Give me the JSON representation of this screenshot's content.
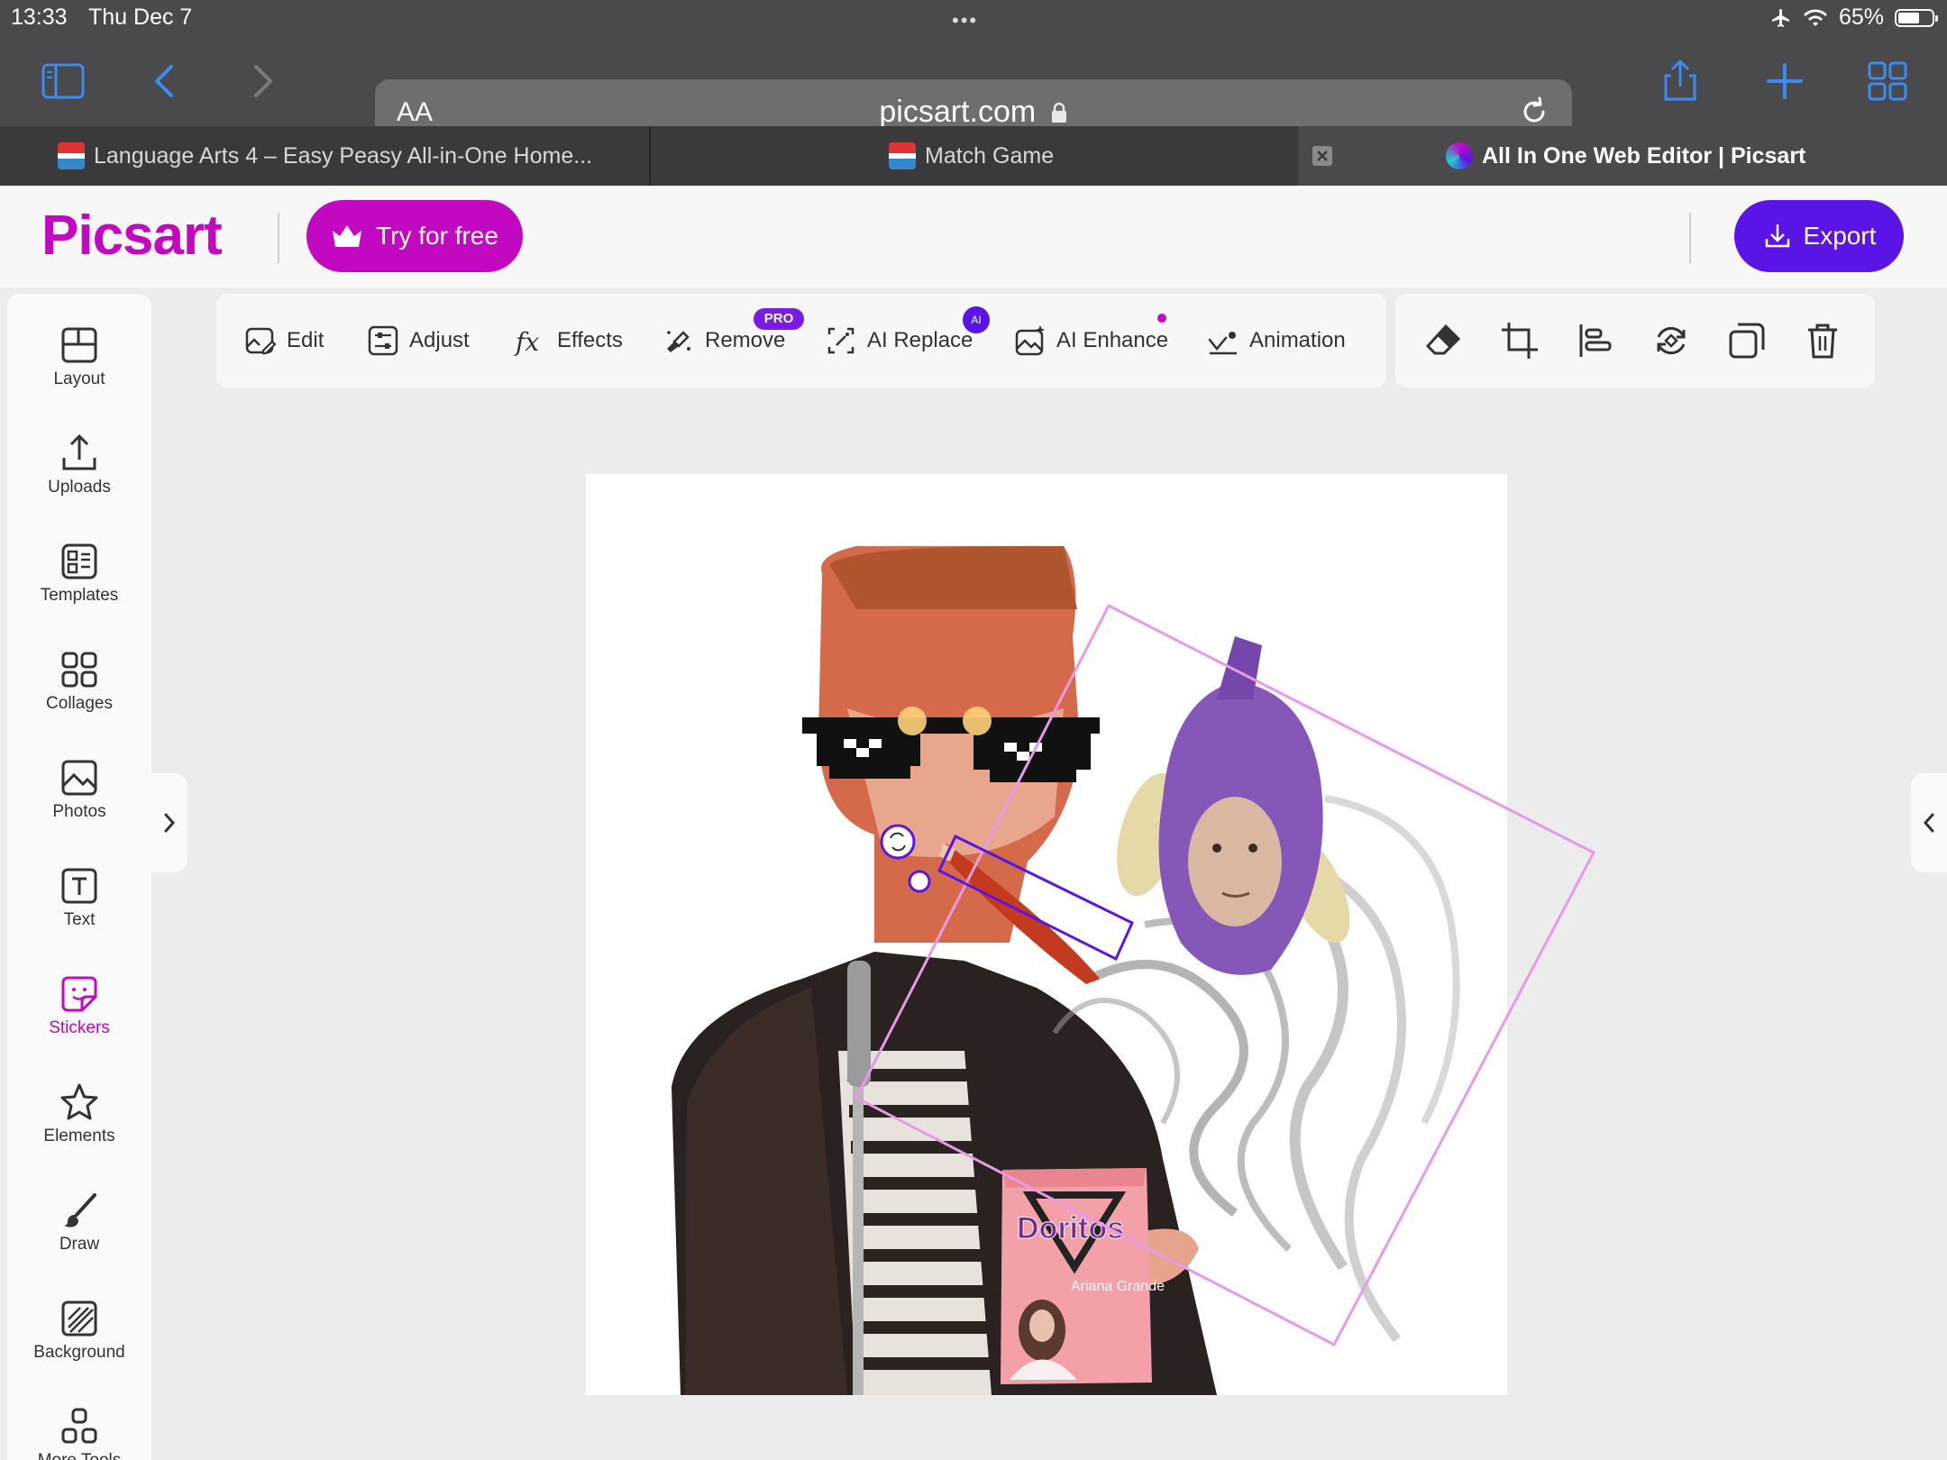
{
  "status": {
    "time": "13:33",
    "date": "Thu Dec 7",
    "battery": "65%",
    "battery_level": 0.65
  },
  "browser": {
    "url_prefix": "AA",
    "url": "picsart.com",
    "tabs": [
      {
        "label": "Language Arts 4 – Easy Peasy All-in-One Home...",
        "active": false
      },
      {
        "label": "Match Game",
        "active": false
      },
      {
        "label": "All In One Web Editor | Picsart",
        "active": true
      }
    ]
  },
  "header": {
    "logo": "Picsart",
    "try_label": "Try for free",
    "export_label": "Export"
  },
  "sidebar": {
    "items": [
      {
        "label": "Layout",
        "icon": "layout-icon"
      },
      {
        "label": "Uploads",
        "icon": "upload-icon"
      },
      {
        "label": "Templates",
        "icon": "templates-icon"
      },
      {
        "label": "Collages",
        "icon": "collages-icon"
      },
      {
        "label": "Photos",
        "icon": "photos-icon"
      },
      {
        "label": "Text",
        "icon": "text-icon"
      },
      {
        "label": "Stickers",
        "icon": "sticker-icon",
        "active": true
      },
      {
        "label": "Elements",
        "icon": "star-icon"
      },
      {
        "label": "Draw",
        "icon": "brush-icon"
      },
      {
        "label": "Background",
        "icon": "background-icon"
      },
      {
        "label": "More Tools",
        "icon": "more-tools-icon"
      }
    ]
  },
  "tools": {
    "items": [
      {
        "label": "Edit"
      },
      {
        "label": "Adjust"
      },
      {
        "label": "Effects"
      },
      {
        "label": "Remove",
        "badge": "PRO"
      },
      {
        "label": "AI Replace",
        "badge": "AI"
      },
      {
        "label": "AI Enhance"
      },
      {
        "label": "Animation"
      }
    ],
    "actions": [
      "eraser-icon",
      "crop-icon",
      "align-icon",
      "flip-icon",
      "duplicate-icon",
      "trash-icon"
    ]
  },
  "canvas": {
    "stickers": [
      "sunglasses",
      "cigarette",
      "smoke",
      "purple-costume",
      "chips-bag"
    ],
    "chips_brand": "Doritos",
    "chips_sub": "Ariana Grande",
    "accent": "#c209c1",
    "selection_color": "#5a14e6"
  }
}
